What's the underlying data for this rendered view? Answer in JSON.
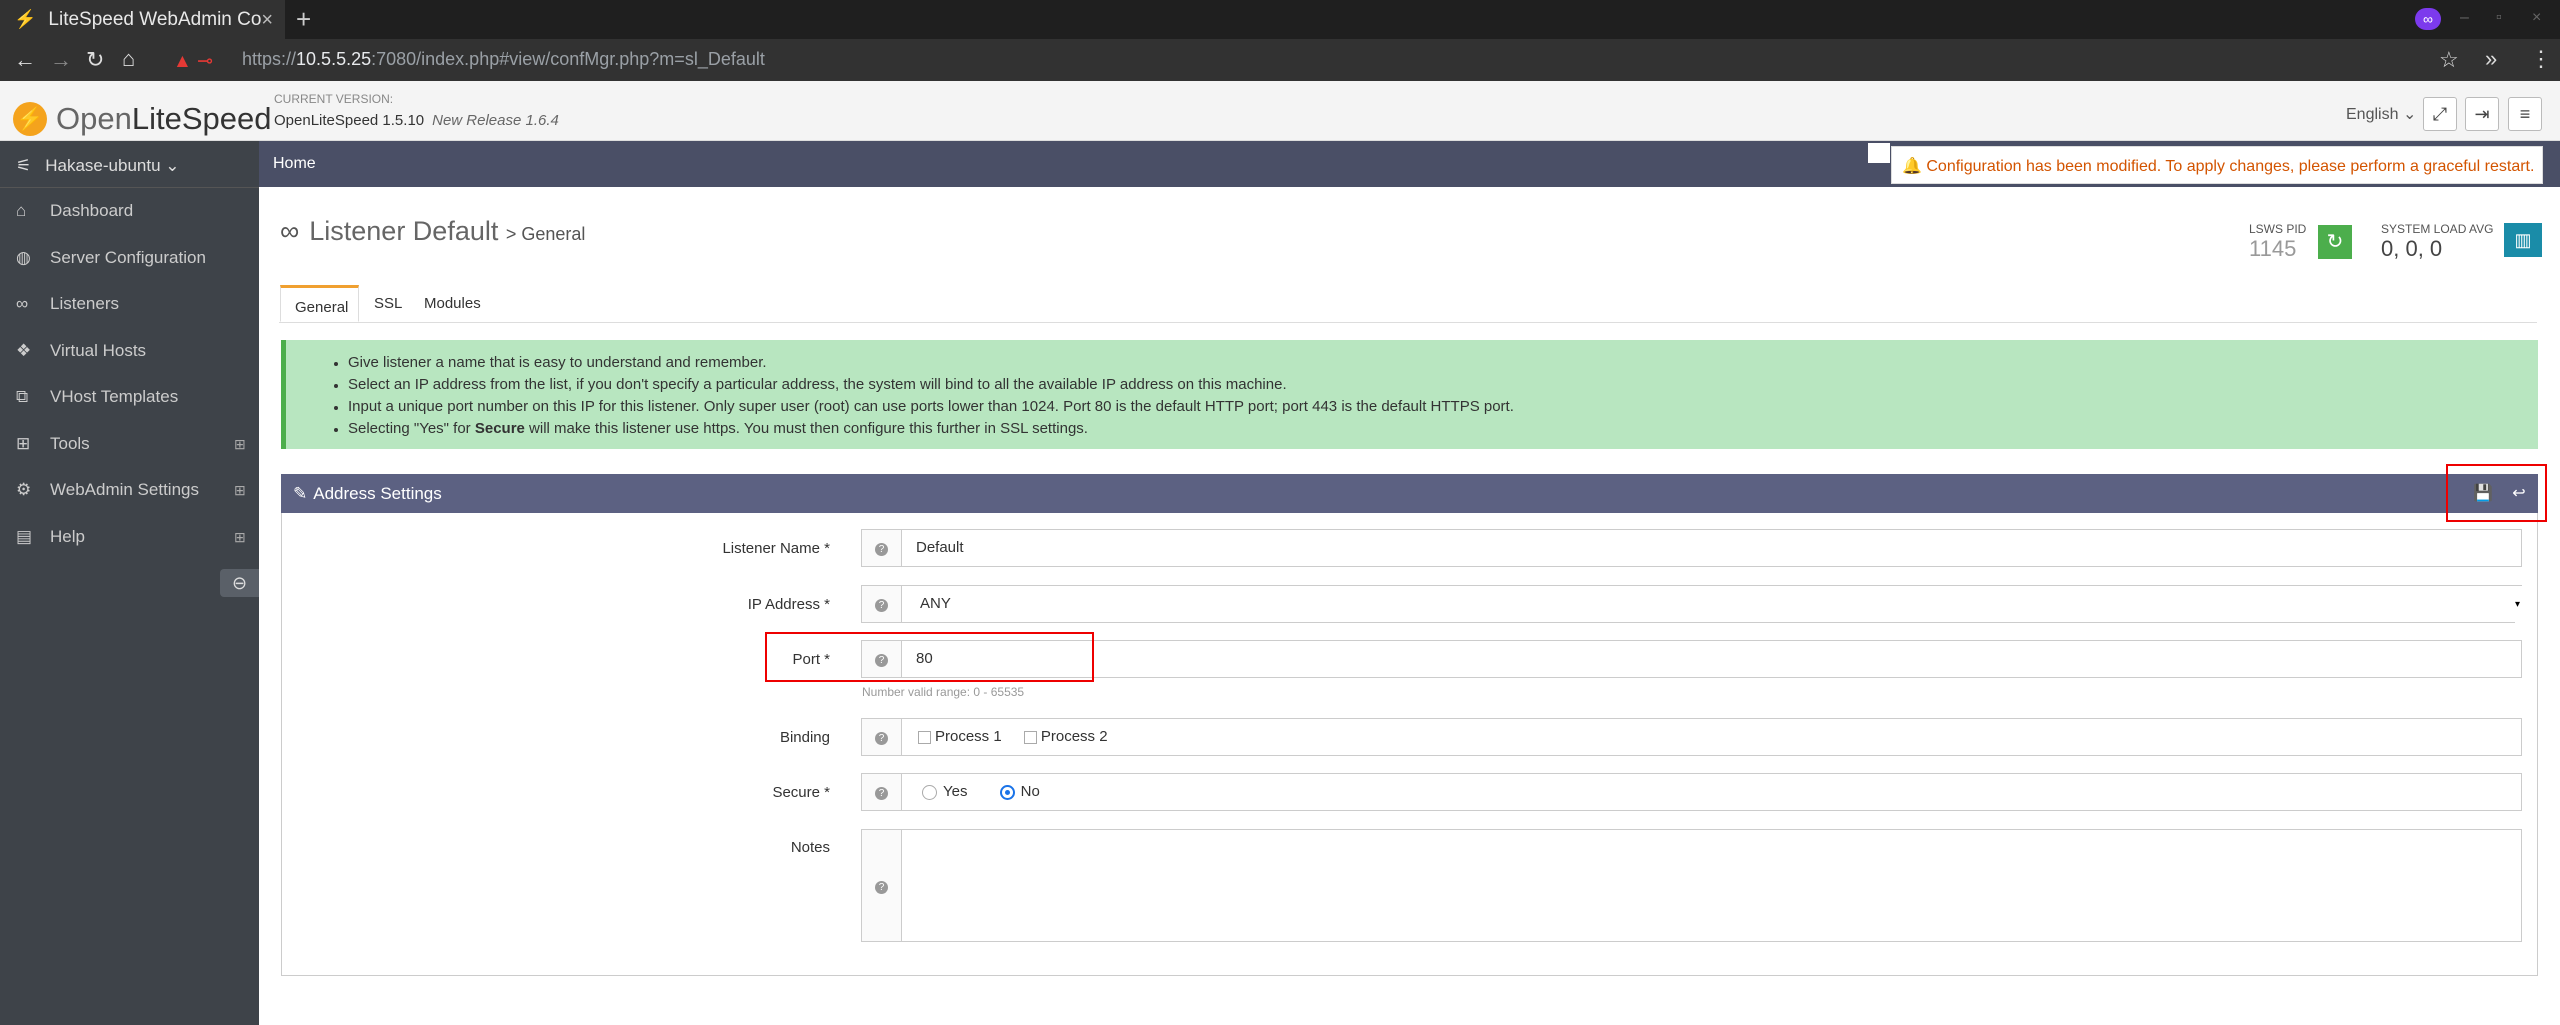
{
  "browser": {
    "tab_title": "LiteSpeed WebAdmin Co",
    "url_prefix": "https://",
    "url_host": "10.5.5.25",
    "url_rest": ":7080/index.php#view/confMgr.php?m=sl_Default"
  },
  "header": {
    "logo_open": "Open",
    "logo_ls": "LiteSpeed",
    "current_version_label": "CURRENT VERSION:",
    "version": "OpenLiteSpeed 1.5.10",
    "new_release": "New Release 1.6.4",
    "language": "English"
  },
  "sidebar": {
    "user": "Hakase-ubuntu",
    "items": [
      {
        "label": "Dashboard",
        "icon": "home-icon"
      },
      {
        "label": "Server Configuration",
        "icon": "globe-icon"
      },
      {
        "label": "Listeners",
        "icon": "link-icon"
      },
      {
        "label": "Virtual Hosts",
        "icon": "cubes-icon"
      },
      {
        "label": "VHost Templates",
        "icon": "copy-icon"
      },
      {
        "label": "Tools",
        "icon": "grid-icon"
      },
      {
        "label": "WebAdmin Settings",
        "icon": "gear-icon"
      },
      {
        "label": "Help",
        "icon": "book-icon"
      }
    ]
  },
  "breadcrumb": {
    "home": "Home"
  },
  "alert": "Configuration has been modified. To apply changes, please perform a graceful restart.",
  "page": {
    "title": "Listener Default",
    "subtitle": "> General",
    "pid_label": "LSWS PID",
    "pid_value": "1145",
    "load_label": "SYSTEM LOAD AVG",
    "load_value": "0, 0, 0"
  },
  "tabs": [
    "General",
    "SSL",
    "Modules"
  ],
  "help_items": [
    "Give listener a name that is easy to understand and remember.",
    "Select an IP address from the list, if you don't specify a particular address, the system will bind to all the available IP address on this machine.",
    "Input a unique port number on this IP for this listener. Only super user (root) can use ports lower than 1024. Port 80 is the default HTTP port; port 443 is the default HTTPS port.",
    {
      "pre": "Selecting \"Yes\" for ",
      "bold": "Secure",
      "post": " will make this listener use https. You must then configure this further in SSL settings."
    }
  ],
  "panel": {
    "title": "Address Settings"
  },
  "form": {
    "listener_name_label": "Listener Name *",
    "listener_name_value": "Default",
    "ip_label": "IP Address *",
    "ip_value": "ANY",
    "port_label": "Port *",
    "port_value": "80",
    "port_hint": "Number valid range: 0 - 65535",
    "binding_label": "Binding",
    "binding_options": [
      "Process 1",
      "Process 2"
    ],
    "secure_label": "Secure *",
    "secure_yes": "Yes",
    "secure_no": "No",
    "secure_selected": "No",
    "notes_label": "Notes",
    "notes_value": ""
  }
}
